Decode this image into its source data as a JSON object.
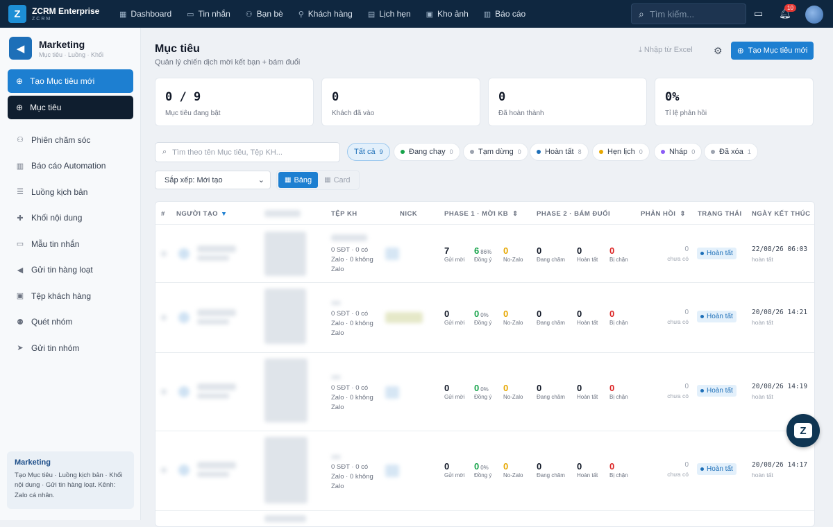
{
  "topbar": {
    "brand_name": "ZCRM Enterprise",
    "brand_sub": "ZCRM",
    "logo_letter": "Z",
    "nav": [
      {
        "label": "Dashboard",
        "icon": "dashboard-icon"
      },
      {
        "label": "Tin nhắn",
        "icon": "message-icon"
      },
      {
        "label": "Bạn bè",
        "icon": "friends-icon"
      },
      {
        "label": "Khách hàng",
        "icon": "customer-icon"
      },
      {
        "label": "Lịch hẹn",
        "icon": "calendar-icon"
      },
      {
        "label": "Kho ảnh",
        "icon": "gallery-icon"
      },
      {
        "label": "Báo cáo",
        "icon": "report-icon"
      }
    ],
    "search_placeholder": "Tìm kiếm...",
    "notification_count": "10",
    "bg_color": "#0f2740"
  },
  "sidebar": {
    "title": "Marketing",
    "subtitle": "Mục tiêu · Luồng · Khối",
    "create_button": "Tạo Mục tiêu mới",
    "active_item": "Mục tiêu",
    "items": [
      {
        "label": "Phiên chăm sóc",
        "icon": "users-icon"
      },
      {
        "label": "Báo cáo Automation",
        "icon": "chart-icon"
      },
      {
        "label": "Luồng kịch bản",
        "icon": "list-icon"
      },
      {
        "label": "Khối nội dung",
        "icon": "puzzle-icon"
      },
      {
        "label": "Mẫu tin nhắn",
        "icon": "chat-icon"
      },
      {
        "label": "Gửi tin hàng loạt",
        "icon": "megaphone-icon"
      },
      {
        "label": "Tệp khách hàng",
        "icon": "contact-card-icon"
      },
      {
        "label": "Quét nhóm",
        "icon": "group-icon"
      },
      {
        "label": "Gửi tin nhóm",
        "icon": "send-icon"
      }
    ],
    "info_title": "Marketing",
    "info_desc": "Tạo Mục tiêu · Luồng kịch bản · Khối nội dung · Gửi tin hàng loạt. Kênh: Zalo cá nhân."
  },
  "page": {
    "title": "Mục tiêu",
    "subtitle": "Quản lý chiến dịch mời kết bạn + bám đuổi",
    "import_excel": "Nhập từ Excel",
    "create_button": "Tạo Mục tiêu mới",
    "accent_color": "#1d7fd1"
  },
  "stats": [
    {
      "value": "0 / 9",
      "label": "Mục tiêu đang bật"
    },
    {
      "value": "0",
      "label": "Khách đã vào"
    },
    {
      "value": "0",
      "label": "Đã hoàn thành"
    },
    {
      "value": "0%",
      "label": "Tỉ lệ phản hồi"
    }
  ],
  "filters": {
    "search_placeholder": "Tìm theo tên Mục tiêu, Tệp KH...",
    "chips": [
      {
        "label": "Tất cả",
        "count": "9",
        "active": true,
        "color": ""
      },
      {
        "label": "Đang chạy",
        "count": "0",
        "color": "#16a34a"
      },
      {
        "label": "Tạm dừng",
        "count": "0",
        "color": "#9ca3af"
      },
      {
        "label": "Hoàn tất",
        "count": "8",
        "color": "#1d6fb8"
      },
      {
        "label": "Hẹn lịch",
        "count": "0",
        "color": "#e6a700"
      },
      {
        "label": "Nháp",
        "count": "0",
        "color": "#8b5cf6"
      },
      {
        "label": "Đã xóa",
        "count": "1",
        "color": "#9ca3af"
      }
    ],
    "sort_label": "Sắp xếp: Mới tạo",
    "view_table": "Bảng",
    "view_card": "Card"
  },
  "table": {
    "headers": {
      "hash": "#",
      "creator": "NGƯỜI TẠO",
      "file": "TỆP KH",
      "nick": "NICK",
      "phase1": "PHASE 1 · MỜI KB",
      "phase2": "PHASE 2 · BÁM ĐUỔI",
      "response": "PHẢN HỒI",
      "status": "TRẠNG THÁI",
      "end_date": "NGÀY KẾT THÚC"
    },
    "metric_labels": {
      "sent": "Gửi mời",
      "accepted": "Đồng ý",
      "nozalo": "No-Zalo",
      "caring": "Đang chăm",
      "done": "Hoàn tất",
      "blocked": "Bị chặn",
      "no_response": "chưa có",
      "end_note": "hoàn tất"
    },
    "rows": [
      {
        "file_info": "0 SĐT · 0 có Zalo · 0 không Zalo",
        "sent": "7",
        "accepted": "6",
        "accepted_pct": "86%",
        "nozalo": "0",
        "caring": "0",
        "done": "0",
        "blocked": "0",
        "response": "0",
        "status": "Hoàn tất",
        "end_date": "22/08/26 06:03"
      },
      {
        "file_info": "0 SĐT · 0 có Zalo · 0 không Zalo",
        "sent": "0",
        "accepted": "0",
        "accepted_pct": "0%",
        "nozalo": "0",
        "caring": "0",
        "done": "0",
        "blocked": "0",
        "response": "0",
        "status": "Hoàn tất",
        "end_date": "20/08/26 14:21"
      },
      {
        "file_info": "0 SĐT · 0 có Zalo · 0 không Zalo",
        "sent": "0",
        "accepted": "0",
        "accepted_pct": "0%",
        "nozalo": "0",
        "caring": "0",
        "done": "0",
        "blocked": "0",
        "response": "0",
        "status": "Hoàn tất",
        "end_date": "20/08/26 14:19"
      },
      {
        "file_info": "0 SĐT · 0 có Zalo · 0 không Zalo",
        "sent": "0",
        "accepted": "0",
        "accepted_pct": "0%",
        "nozalo": "0",
        "caring": "0",
        "done": "0",
        "blocked": "0",
        "response": "0",
        "status": "Hoàn tất",
        "end_date": "20/08/26 14:17"
      }
    ]
  }
}
